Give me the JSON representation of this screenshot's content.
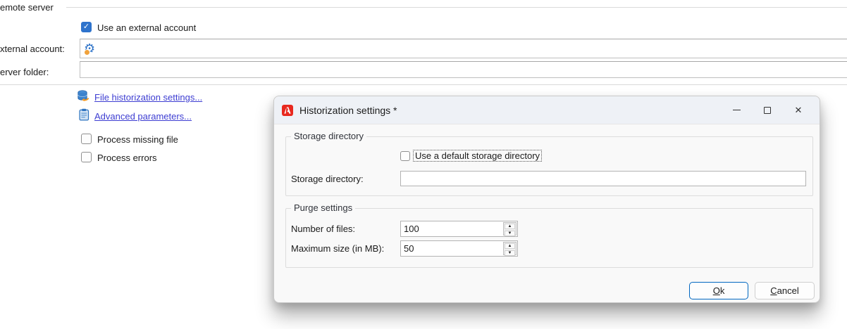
{
  "background_form": {
    "group_label": "emote server",
    "external_account_checkbox_label": "Use an external account",
    "external_account_label": "xternal account:",
    "external_account_value": "",
    "server_folder_label": "erver folder:",
    "server_folder_value": "",
    "file_historization_link": "File historization settings...",
    "advanced_parameters_link": "Advanced parameters...",
    "process_missing_file_label": "Process missing file",
    "process_errors_label": "Process errors"
  },
  "dialog": {
    "title": "Historization settings *",
    "storage_group": {
      "label": "Storage directory",
      "default_checkbox_label": "Use a default storage directory",
      "directory_label": "Storage directory:",
      "directory_value": ""
    },
    "purge_group": {
      "label": "Purge settings",
      "number_of_files_label": "Number of files:",
      "number_of_files_value": "100",
      "max_size_label": "Maximum size (in MB):",
      "max_size_value": "50"
    },
    "buttons": {
      "ok_mnemonic": "O",
      "ok_rest": "k",
      "cancel_mnemonic": "C",
      "cancel_rest": "ancel"
    }
  },
  "icons": {
    "checkmark": "✓",
    "gear": "⚙",
    "close": "✕",
    "spin_up": "▲",
    "spin_down": "▼"
  },
  "colors": {
    "accent_checkbox": "#2e73cc",
    "link": "#3d3dd2",
    "titlebar": "#eef1f6",
    "dialog_body": "#f9f9f9",
    "app_icon_red": "#e8281e",
    "ok_border": "#0067c0"
  }
}
